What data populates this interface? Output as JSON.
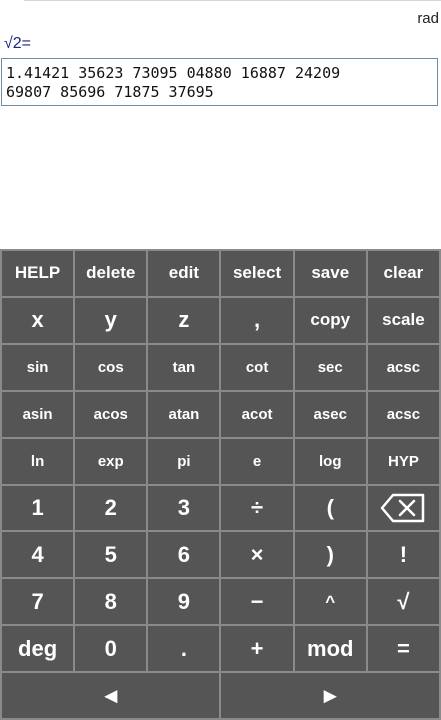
{
  "header": {
    "angle_mode": "rad"
  },
  "display": {
    "expression": "√2=",
    "result_line1": "1.41421 35623 73095 04880 16887 24209",
    "result_line2": "69807 85696 71875 37695"
  },
  "keys": {
    "row1": [
      "HELP",
      "delete",
      "edit",
      "select",
      "save",
      "clear"
    ],
    "row2": [
      "x",
      "y",
      "z",
      ",",
      "copy",
      "scale"
    ],
    "row3": [
      "sin",
      "cos",
      "tan",
      "cot",
      "sec",
      "acsc"
    ],
    "row4": [
      "asin",
      "acos",
      "atan",
      "acot",
      "asec",
      "acsc"
    ],
    "row5": [
      "ln",
      "exp",
      "pi",
      "e",
      "log",
      "HYP"
    ],
    "row6": [
      "1",
      "2",
      "3",
      "÷",
      "("
    ],
    "row7": [
      "4",
      "5",
      "6",
      "×",
      ")",
      "!"
    ],
    "row8": [
      "7",
      "8",
      "9",
      "−",
      "^",
      "√"
    ],
    "row9": [
      "deg",
      "0",
      ".",
      "+",
      "mod",
      "="
    ],
    "row10": [
      "◄",
      "►"
    ]
  },
  "icons": {
    "backspace": "backspace-icon"
  }
}
